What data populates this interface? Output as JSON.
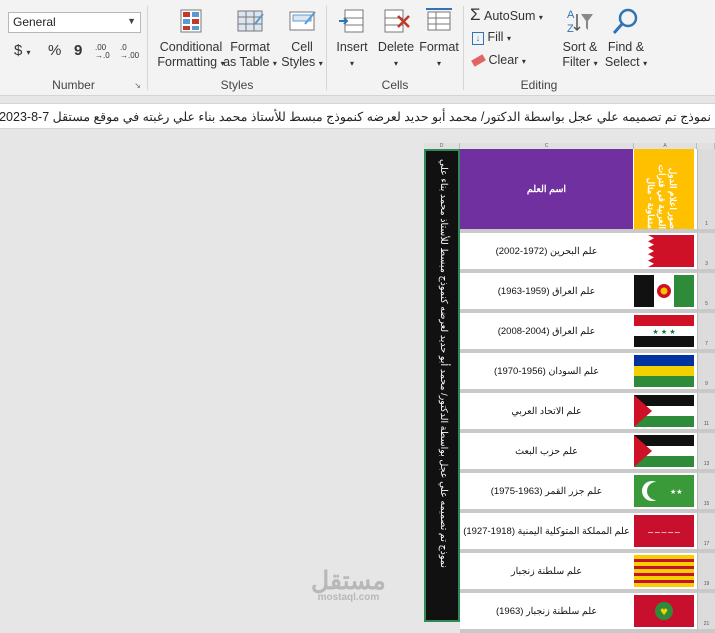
{
  "ribbon": {
    "number": {
      "format_value": "General",
      "currency_symbol": "$",
      "percent_symbol": "%",
      "comma_symbol": "9",
      "increase_decimal": ".00 →.0",
      "decrease_decimal": ".0 →.00",
      "label": "Number"
    },
    "styles": {
      "conditional_formatting": "Conditional Formatting",
      "format_as_table": "Format as Table",
      "cell_styles": "Cell Styles",
      "label": "Styles"
    },
    "cells": {
      "insert": "Insert",
      "delete": "Delete",
      "format": "Format",
      "label": "Cells"
    },
    "editing": {
      "autosum": "AutoSum",
      "fill": "Fill",
      "clear": "Clear",
      "sort_filter": "Sort & Filter",
      "find_select": "Find & Select",
      "label": "Editing"
    }
  },
  "formula_bar": {
    "text": "نموذج تم تصميمه علي عجل بواسطة الدكتور/ محمد أبو حديد لعرضه كنموذج مبسط للأستاذ محمد بناء علي رغبته في موقع مستقل 7-8-2023"
  },
  "sheet": {
    "columns": [
      "D",
      "C",
      "A"
    ],
    "column_d_text": "نموذج تم تصميمه علي عجل بواسطة الدكتور/ محمد أبو حديد لعرضه كنموذج مبسط للأستاذ محمد بناء علي",
    "header": {
      "name": "اسم العلم",
      "flag": "صور اعلام الدول العربية في فترات متفاوتة - مثال",
      "row_num": "1"
    },
    "rows": [
      {
        "name": "علم البحرين (1972-2002)",
        "flag": "bahrain-flag",
        "row_num": "3"
      },
      {
        "name": "علم العراق (1959-1963)",
        "flag": "iraq-1959-flag",
        "row_num": "5"
      },
      {
        "name": "علم العراق (2004-2008)",
        "flag": "iraq-2004-flag",
        "row_num": "7"
      },
      {
        "name": "علم السودان (1956-1970)",
        "flag": "sudan-flag",
        "row_num": "9"
      },
      {
        "name": "علم الاتحاد العربي",
        "flag": "arab-federation-flag",
        "row_num": "11"
      },
      {
        "name": "علم حزب البعث",
        "flag": "baath-flag",
        "row_num": "13"
      },
      {
        "name": "علم جزر القمر (1963-1975)",
        "flag": "comoros-flag",
        "row_num": "15"
      },
      {
        "name": "علم المملكة المتوكلية اليمنية (1918-1927)",
        "flag": "yemen-kingdom-flag",
        "row_num": "17"
      },
      {
        "name": "علم سلطنة زنجبار",
        "flag": "zanzibar-flag",
        "row_num": "19"
      },
      {
        "name": "علم سلطنة زنجبار (1963)",
        "flag": "zanzibar-1963-flag",
        "row_num": "21"
      }
    ]
  },
  "watermark": {
    "main": "مستقل",
    "sub": "mostaql.com"
  }
}
